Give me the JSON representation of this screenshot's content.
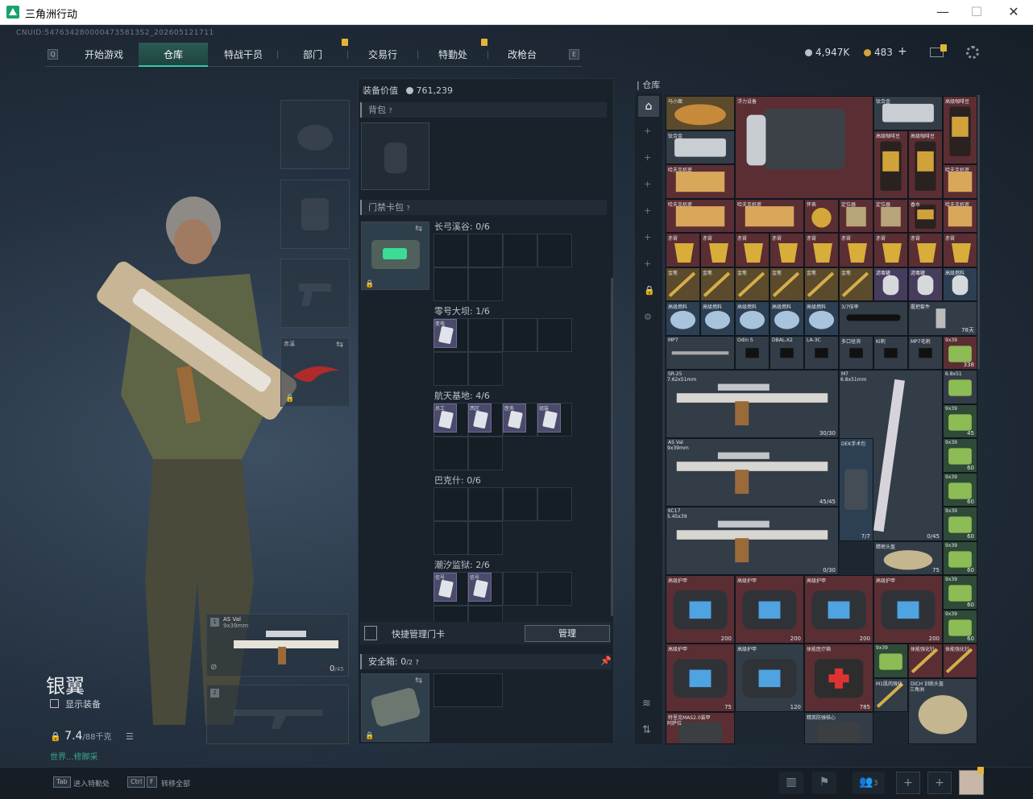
{
  "window": {
    "title": "三角洲行动",
    "min": "—",
    "max": "☐",
    "close": "✕"
  },
  "cnuid": "CNUID:5476342800004735813S2_202605121711",
  "nav": {
    "left_key": "Q",
    "right_key": "E",
    "tabs": [
      {
        "label": "开始游戏"
      },
      {
        "label": "仓库"
      },
      {
        "label": "特战干员"
      },
      {
        "label": "部门"
      },
      {
        "label": "交易行"
      },
      {
        "label": "特勤处"
      },
      {
        "label": "改枪台"
      }
    ]
  },
  "currency": {
    "silver": "4,947K",
    "gold": "483",
    "plus": "+"
  },
  "loadout": {
    "value_label": "装备价值",
    "value": "761,239",
    "backpack_label": "背包",
    "help": "?",
    "keycard_label": "门禁卡包",
    "melee_label": "赤溪",
    "maps": [
      {
        "name": "长弓溪谷: 0/6"
      },
      {
        "name": "零号大坝: 1/6"
      },
      {
        "name": "航天基地: 4/6"
      },
      {
        "name": "巴克什: 0/6"
      },
      {
        "name": "潮汐监狱: 2/6"
      }
    ],
    "card_labels": {
      "a": "变电",
      "b": "员工",
      "c": "西区",
      "d": "医务",
      "e": "组装",
      "f": "信号",
      "g": "信号"
    },
    "quick_manage": "快捷管理门卡",
    "manage_btn": "管理",
    "safebox_label": "安全箱:",
    "safebox_value": "0",
    "safebox_max": "/2"
  },
  "weapon_slots": {
    "slot1_idx": "1",
    "slot1_name": "AS Val",
    "slot1_cal": "9x39mm",
    "slot1_ammo": "0",
    "slot1_max": "/45",
    "slot2_idx": "2"
  },
  "character": {
    "name": "银翼",
    "show_equipment": "显示装备",
    "weight": "7.4",
    "weight_max": "/88千克",
    "weight_status": "世界...修脚采"
  },
  "stash": {
    "title": "仓库",
    "items": {
      "i1": "马小面",
      "i2": "浮力设备",
      "i3": "钛合金",
      "i4": "高级咖啡豆",
      "i5": "钛合金",
      "i6": "高级咖啡豆",
      "i7": "高级咖啡豆",
      "i8": "哈夫克机密",
      "i9": "哈夫克机密",
      "i10": "哈夫克机密",
      "i11": "怀表",
      "i12": "定位器",
      "i13": "定位器",
      "i14": "香水",
      "i15": "赤霄",
      "i16": "金笔",
      "i17": "滤毒罐",
      "i18": "高级燃料",
      "i19": "3/7倍率",
      "i20": "握把套件",
      "i21": "MP7",
      "i22": "弹牙轻枪管",
      "i23": "Odin S",
      "i24": "DBAL-X2",
      "i25": "LA-3C",
      "i26": "多口径消",
      "i27": "KI刺",
      "i28": "MP7毛刺",
      "i29": "SR-25",
      "i30": "7.62x51mm",
      "i31": "M7",
      "i32": "6.8x51mm",
      "i33": "AS Val",
      "i34": "9x39mm",
      "i35": "DEK手术包",
      "i36": "KC17",
      "i37": "5.45x39",
      "i38": "精密头盔",
      "i39": "高级护甲",
      "i40": "体能强化针",
      "i41": "体能医疗箱",
      "i42": "9x39",
      "i43": "M1肌肉强化",
      "i44": "DICH 训练头盔",
      "i45": "三角洲",
      "i46": "特里克MAS2.0装甲",
      "i47": "精英防弹核心",
      "i48": "阿萨拉",
      "i49": "6.8x51",
      "i50": "9x39"
    },
    "nums": {
      "n1": "78天",
      "n2": "30/30",
      "n3": "45/45",
      "n4": "7/7",
      "n5": "0/30",
      "n6": "0/45",
      "n7": "75",
      "n8": "200",
      "n9": "200",
      "n10": "200",
      "n11": "200",
      "n12": "75",
      "n13": "120",
      "n14": "785",
      "n15": "338",
      "n16": "45",
      "n17": "60",
      "n18": "60",
      "n19": "60",
      "n20": "60",
      "n21": "60",
      "n22": "60",
      "n23": "60",
      "n24": "60"
    }
  },
  "bottom": {
    "tab_key": "Tab",
    "tab_text": "进入特勤处",
    "ctrl_key": "Ctrl",
    "f_key": "F",
    "ctrl_text": "转移全部",
    "friends_count": "3"
  },
  "colors": {
    "accent": "#37c9a4",
    "badge": "#e4b43a",
    "rarity_red": "#5a2e33",
    "rarity_gold": "#5b4a2c",
    "rarity_purple": "#463c5c",
    "rarity_blue": "#2d3f52"
  }
}
